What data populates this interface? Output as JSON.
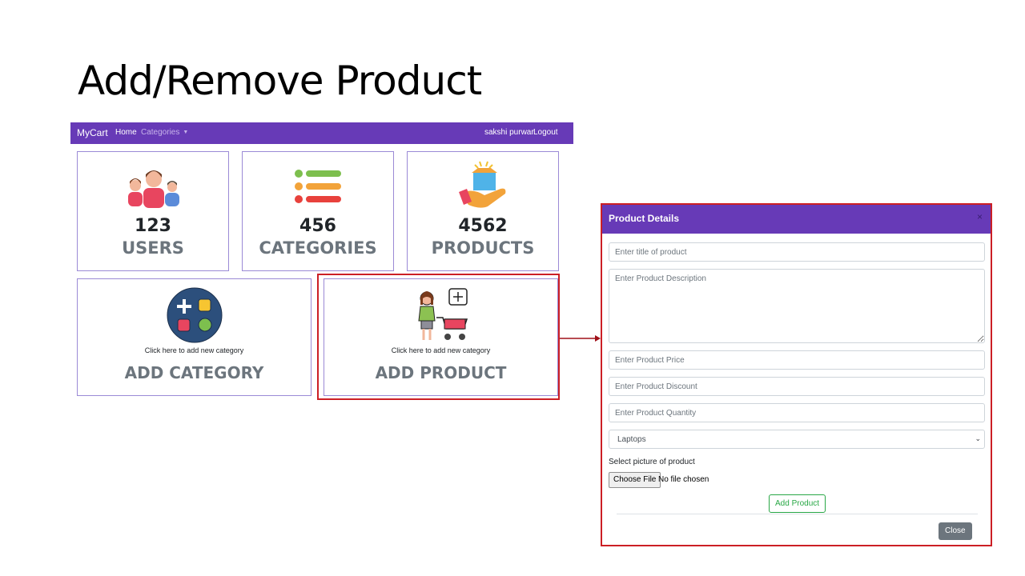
{
  "slide": {
    "title": "Add/Remove Product"
  },
  "navbar": {
    "brand": "MyCart",
    "home": "Home",
    "categories": "Categories",
    "user": "sakshi purwar",
    "logout": "Logout"
  },
  "stats": [
    {
      "count": "123",
      "label": "USERS",
      "icon": "users-icon"
    },
    {
      "count": "456",
      "label": "CATEGORIES",
      "icon": "list-icon"
    },
    {
      "count": "4562",
      "label": "PRODUCTS",
      "icon": "product-box-icon"
    }
  ],
  "actions": [
    {
      "hint": "Click here to add new category",
      "label": "ADD CATEGORY",
      "icon": "add-category-icon"
    },
    {
      "hint": "Click here to add new category",
      "label": "ADD PRODUCT",
      "icon": "shopping-cart-icon"
    }
  ],
  "modal": {
    "title": "Product Details",
    "close_x": "×",
    "title_placeholder": "Enter title of product",
    "description_placeholder": "Enter Product Description",
    "price_placeholder": "Enter Product Price",
    "discount_placeholder": "Enter Product Discount",
    "quantity_placeholder": "Enter Product Quantity",
    "category_selected": "Laptops",
    "picture_label": "Select picture of product",
    "choose_file": "Choose File",
    "file_status": "No file chosen",
    "add_button": "Add Product",
    "close_button": "Close"
  },
  "colors": {
    "brand": "#673ab7",
    "highlight": "#cc1f25",
    "success": "#28a745",
    "secondary": "#6c757d"
  }
}
